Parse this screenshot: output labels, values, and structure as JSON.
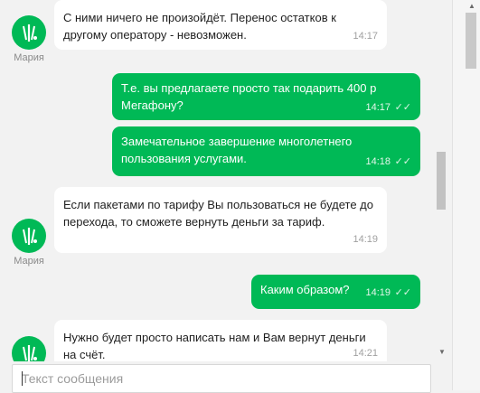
{
  "agent": {
    "name": "Мария"
  },
  "messages": [
    {
      "direction": "in",
      "text": "С ними ничего не произойдёт. Перенос остатков к другому оператору - невозможен.",
      "time": "14:17"
    },
    {
      "direction": "out",
      "text": "Т.е. вы предлагаете просто так подарить 400 р Мегафону?",
      "time": "14:17"
    },
    {
      "direction": "out",
      "text": "Замечательное завершение многолетнего пользования услугами.",
      "time": "14:18"
    },
    {
      "direction": "in",
      "text": "Если пакетами по тарифу Вы пользоваться не будете до перехода, то сможете вернуть деньги за тариф.",
      "time": "14:19"
    },
    {
      "direction": "out",
      "text": "Каким образом?",
      "time": "14:19"
    },
    {
      "direction": "in",
      "text": "Нужно будет просто написать нам и Вам вернут деньги на счёт.",
      "time": "14:21"
    }
  ],
  "composer": {
    "placeholder": "Текст сообщения",
    "value": ""
  },
  "icons": {
    "read_receipt": "double-check-icon",
    "avatar": "operator-logo-icon"
  },
  "colors": {
    "accent": "#00b956",
    "incoming_bubble": "#ffffff",
    "background": "#f2f2f2"
  }
}
